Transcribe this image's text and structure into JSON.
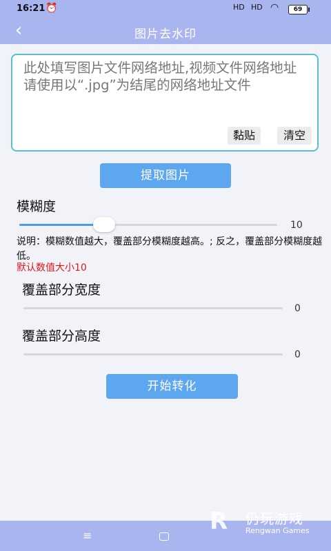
{
  "status_bar": {
    "time": "16:21",
    "alarm_icon": "alarm-clock-icon",
    "signal1": "HD",
    "signal2": "HD",
    "wifi_icon": "wifi-icon",
    "battery": "69"
  },
  "app_bar": {
    "back_icon": "back-chevron-icon",
    "back_glyph": "‹",
    "title": "图片去水印"
  },
  "url_input": {
    "placeholder": "此处填写图片文件网络地址,视频文件网络地址请使用以“.jpg”为结尾的网络地址文件",
    "value": "",
    "paste_label": "黏贴",
    "clear_label": "清空"
  },
  "extract_button": "提取图片",
  "blur": {
    "label": "模糊度",
    "value": "10",
    "fraction": 0.33,
    "description": "说明：模糊数值越大，覆盖部分模糊度越高。; 反之，覆盖部分模糊度越低。",
    "default_note": "默认数值大小10"
  },
  "cover_width": {
    "label": "覆盖部分宽度",
    "value": "0",
    "fraction": 0
  },
  "cover_height": {
    "label": "覆盖部分高度",
    "value": "0",
    "fraction": 0
  },
  "convert_button": "开始转化",
  "nav_bar": {
    "menu_glyph": "≡"
  },
  "watermark": {
    "name": "仍玩游戏",
    "sub": "Rengwan Games"
  },
  "colors": {
    "bar": "#a9b5ef",
    "primary": "#5ca7f0",
    "accent_border": "#55c2cb",
    "warning": "#d9191c"
  }
}
